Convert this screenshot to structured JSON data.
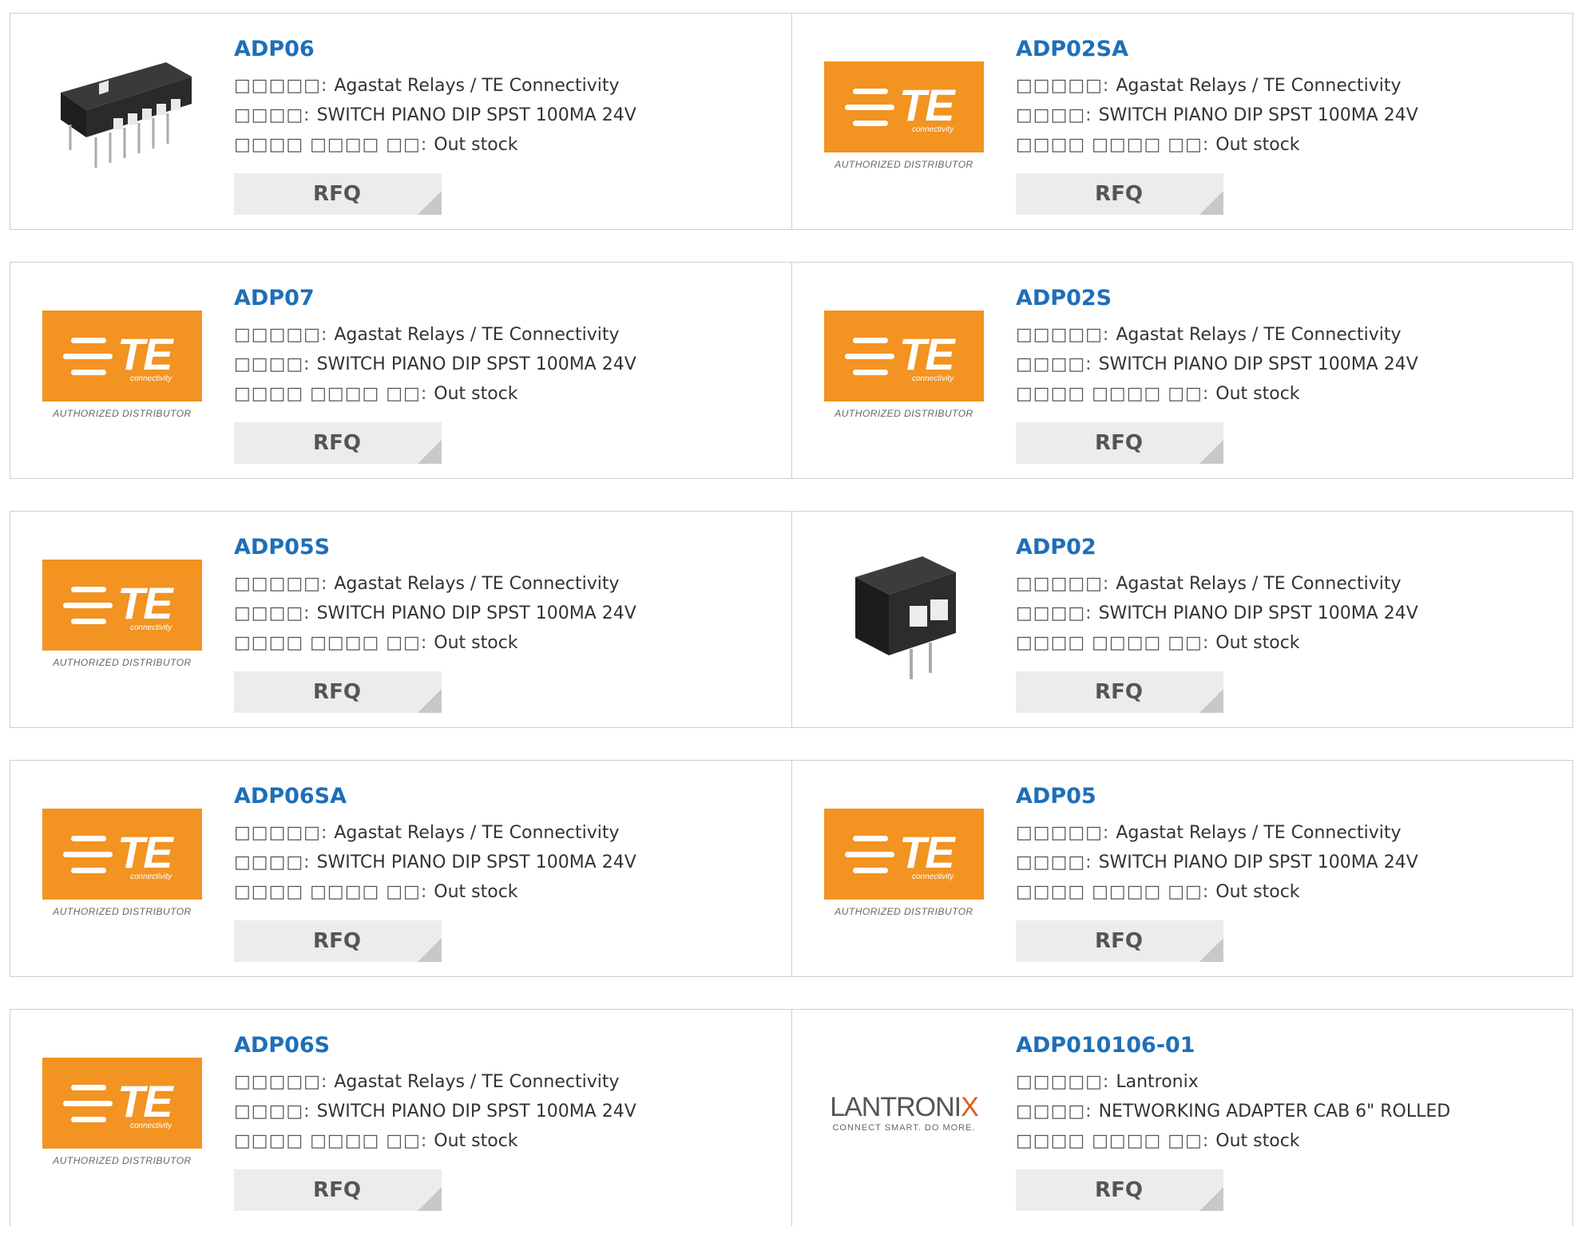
{
  "labels": {
    "manufacturer": "□□□□□:",
    "description": "□□□□:",
    "stock": "□□□□ □□□□ □□:",
    "rfq": "RFQ"
  },
  "logos": {
    "te_text": "TE",
    "te_sub": "connectivity",
    "te_dist": "AUTHORIZED DISTRIBUTOR",
    "lantronix_name_a": "LANTRONI",
    "lantronix_name_b": "X",
    "lantronix_sub": "CONNECT SMART. DO MORE."
  },
  "products": [
    {
      "part": "ADP06",
      "manufacturer": "Agastat Relays / TE Connectivity",
      "description": "SWITCH PIANO DIP SPST 100MA 24V",
      "stock": "Out stock",
      "image": "dip-switch-6"
    },
    {
      "part": "ADP02SA",
      "manufacturer": "Agastat Relays / TE Connectivity",
      "description": "SWITCH PIANO DIP SPST 100MA 24V",
      "stock": "Out stock",
      "image": "te-logo"
    },
    {
      "part": "ADP07",
      "manufacturer": "Agastat Relays / TE Connectivity",
      "description": "SWITCH PIANO DIP SPST 100MA 24V",
      "stock": "Out stock",
      "image": "te-logo"
    },
    {
      "part": "ADP02S",
      "manufacturer": "Agastat Relays / TE Connectivity",
      "description": "SWITCH PIANO DIP SPST 100MA 24V",
      "stock": "Out stock",
      "image": "te-logo"
    },
    {
      "part": "ADP05S",
      "manufacturer": "Agastat Relays / TE Connectivity",
      "description": "SWITCH PIANO DIP SPST 100MA 24V",
      "stock": "Out stock",
      "image": "te-logo"
    },
    {
      "part": "ADP02",
      "manufacturer": "Agastat Relays / TE Connectivity",
      "description": "SWITCH PIANO DIP SPST 100MA 24V",
      "stock": "Out stock",
      "image": "dip-switch-2"
    },
    {
      "part": "ADP06SA",
      "manufacturer": "Agastat Relays / TE Connectivity",
      "description": "SWITCH PIANO DIP SPST 100MA 24V",
      "stock": "Out stock",
      "image": "te-logo"
    },
    {
      "part": "ADP05",
      "manufacturer": "Agastat Relays / TE Connectivity",
      "description": "SWITCH PIANO DIP SPST 100MA 24V",
      "stock": "Out stock",
      "image": "te-logo"
    },
    {
      "part": "ADP06S",
      "manufacturer": "Agastat Relays / TE Connectivity",
      "description": "SWITCH PIANO DIP SPST 100MA 24V",
      "stock": "Out stock",
      "image": "te-logo"
    },
    {
      "part": "ADP010106-01",
      "manufacturer": "Lantronix",
      "description": "NETWORKING ADAPTER CAB 6\" ROLLED",
      "stock": "Out stock",
      "image": "lantronix-logo"
    }
  ]
}
